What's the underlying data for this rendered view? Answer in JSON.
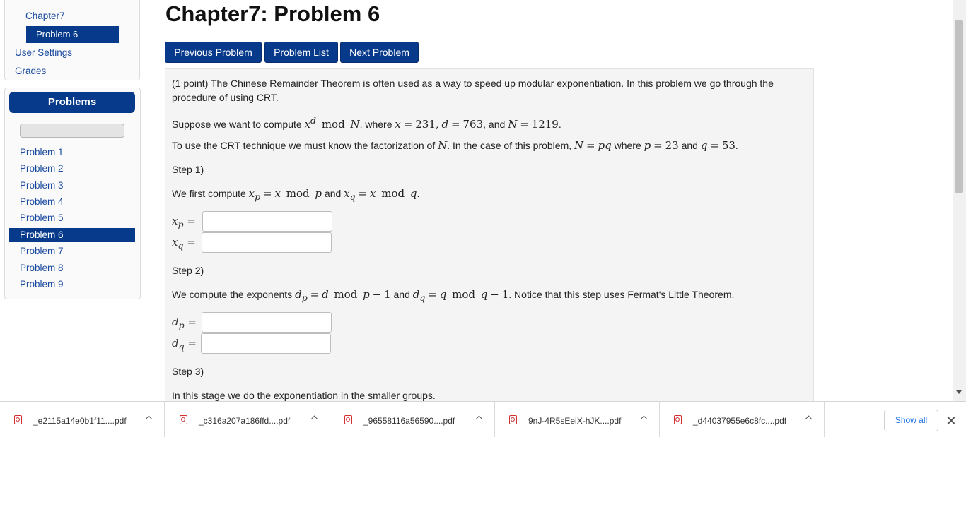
{
  "sidebar": {
    "nav": {
      "chapter": "Chapter7",
      "current_problem": "Problem 6",
      "user_settings": "User Settings",
      "grades": "Grades"
    },
    "problems_title": "Problems",
    "progress_fraction": 0,
    "problems": [
      {
        "label": "Problem 1"
      },
      {
        "label": "Problem 2"
      },
      {
        "label": "Problem 3"
      },
      {
        "label": "Problem 4"
      },
      {
        "label": "Problem 5"
      },
      {
        "label": "Problem 6"
      },
      {
        "label": "Problem 7"
      },
      {
        "label": "Problem 8"
      },
      {
        "label": "Problem 9"
      }
    ]
  },
  "main": {
    "title": "Chapter7: Problem 6",
    "buttons": {
      "previous": "Previous Problem",
      "list": "Problem List",
      "next": "Next Problem"
    },
    "problem": {
      "intro": "(1 point) The Chinese Remainder Theorem is often used as a way to speed up modular exponentiation. In this problem we go through the procedure of using CRT.",
      "suppose": {
        "lead": "Suppose we want to compute",
        "where": ", where",
        "x_val": "231",
        "d_val": "763",
        "and": ", and",
        "n_val": "1219"
      },
      "crt": {
        "lead": "To use the CRT technique we must know the factorization of",
        "mid": ". In the case of this problem,",
        "where": "where",
        "p_val": "23",
        "and": "and",
        "q_val": "53"
      },
      "step1": "Step 1)",
      "step1_text": {
        "lead": "We first compute",
        "and": "and"
      },
      "step2": "Step 2)",
      "step2_text": {
        "lead": "We compute the exponents",
        "and": "and",
        "tail": ". Notice that this step uses Fermat's Little Theorem."
      },
      "step3": "Step 3)",
      "step3_text": "In this stage we do the exponentiation in the smaller groups.",
      "inputs": {
        "xp": "",
        "xq": "",
        "dp": "",
        "dq": ""
      }
    }
  },
  "downloads": {
    "items": [
      {
        "name": "_e2115a14e0b1f11....pdf"
      },
      {
        "name": "_c316a207a186ffd....pdf"
      },
      {
        "name": "_96558116a56590....pdf"
      },
      {
        "name": "9nJ-4R5sEeiX-hJK....pdf"
      },
      {
        "name": "_d44037955e6c8fc....pdf"
      }
    ],
    "show_all": "Show all"
  },
  "colors": {
    "accent": "#083a8c",
    "link": "#1a4aa0",
    "download_link": "#1a73e8",
    "pdf_icon": "#d32f2f"
  }
}
